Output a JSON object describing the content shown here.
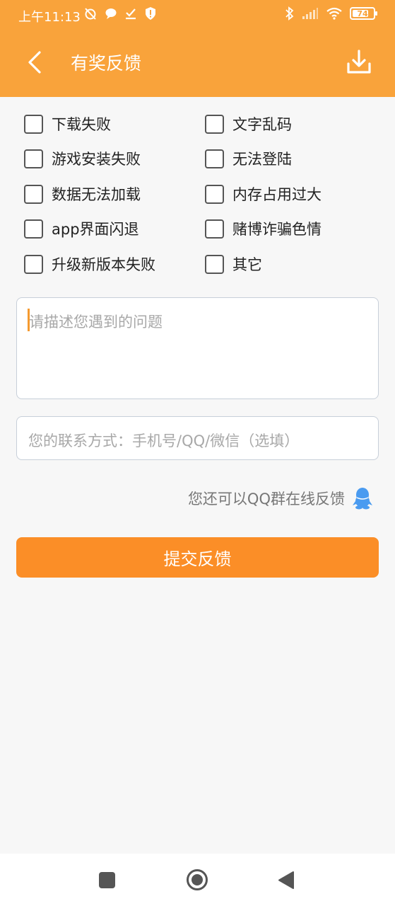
{
  "status_bar": {
    "time": "上午11:13",
    "battery": "74"
  },
  "header": {
    "title": "有奖反馈",
    "back_icon": "chevron-left-icon",
    "download_icon": "download-icon",
    "background_color": "#f9a33b"
  },
  "options": [
    {
      "label": "下载失败",
      "checked": false
    },
    {
      "label": "文字乱码",
      "checked": false
    },
    {
      "label": "游戏安装失败",
      "checked": false
    },
    {
      "label": "无法登陆",
      "checked": false
    },
    {
      "label": "数据无法加载",
      "checked": false
    },
    {
      "label": "内存占用过大",
      "checked": false
    },
    {
      "label": "app界面闪退",
      "checked": false
    },
    {
      "label": "赌博诈骗色情",
      "checked": false
    },
    {
      "label": "升级新版本失败",
      "checked": false
    },
    {
      "label": "其它",
      "checked": false
    }
  ],
  "description": {
    "value": "",
    "placeholder": "请描述您遇到的问题"
  },
  "contact": {
    "value": "",
    "placeholder": "您的联系方式：手机号/QQ/微信（选填）"
  },
  "qq_group": {
    "text": "您还可以QQ群在线反馈",
    "icon": "qq-penguin-icon",
    "icon_color": "#4a9bf0"
  },
  "submit": {
    "label": "提交反馈",
    "color": "#fb8e27"
  },
  "nav_bar": {
    "recent_icon": "square-icon",
    "home_icon": "circle-home-icon",
    "back_icon": "triangle-back-icon"
  }
}
